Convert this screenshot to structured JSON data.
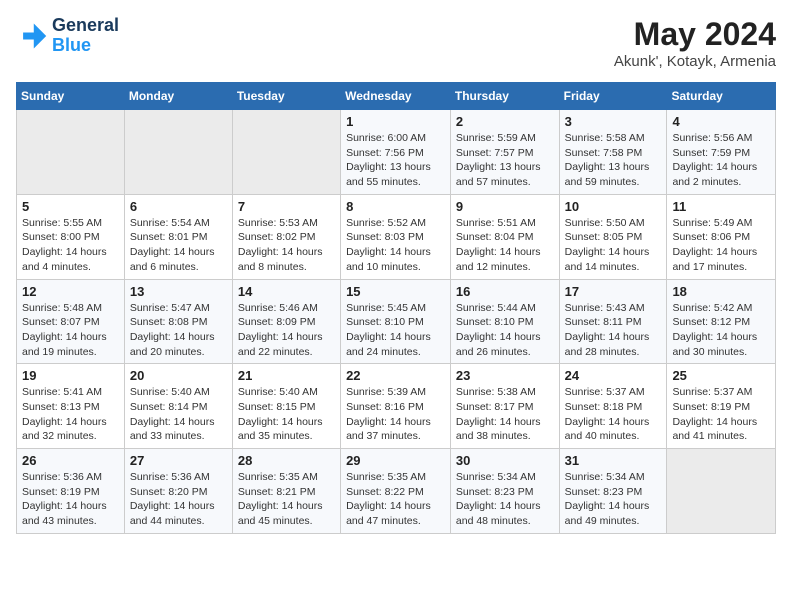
{
  "header": {
    "logo_line1": "General",
    "logo_line2": "Blue",
    "title": "May 2024",
    "subtitle": "Akunk', Kotayk, Armenia"
  },
  "days_of_week": [
    "Sunday",
    "Monday",
    "Tuesday",
    "Wednesday",
    "Thursday",
    "Friday",
    "Saturday"
  ],
  "weeks": [
    {
      "days": [
        {
          "empty": true
        },
        {
          "empty": true
        },
        {
          "empty": true
        },
        {
          "number": "1",
          "sunrise": "6:00 AM",
          "sunset": "7:56 PM",
          "daylight": "13 hours and 55 minutes."
        },
        {
          "number": "2",
          "sunrise": "5:59 AM",
          "sunset": "7:57 PM",
          "daylight": "13 hours and 57 minutes."
        },
        {
          "number": "3",
          "sunrise": "5:58 AM",
          "sunset": "7:58 PM",
          "daylight": "13 hours and 59 minutes."
        },
        {
          "number": "4",
          "sunrise": "5:56 AM",
          "sunset": "7:59 PM",
          "daylight": "14 hours and 2 minutes."
        }
      ]
    },
    {
      "days": [
        {
          "number": "5",
          "sunrise": "5:55 AM",
          "sunset": "8:00 PM",
          "daylight": "14 hours and 4 minutes."
        },
        {
          "number": "6",
          "sunrise": "5:54 AM",
          "sunset": "8:01 PM",
          "daylight": "14 hours and 6 minutes."
        },
        {
          "number": "7",
          "sunrise": "5:53 AM",
          "sunset": "8:02 PM",
          "daylight": "14 hours and 8 minutes."
        },
        {
          "number": "8",
          "sunrise": "5:52 AM",
          "sunset": "8:03 PM",
          "daylight": "14 hours and 10 minutes."
        },
        {
          "number": "9",
          "sunrise": "5:51 AM",
          "sunset": "8:04 PM",
          "daylight": "14 hours and 12 minutes."
        },
        {
          "number": "10",
          "sunrise": "5:50 AM",
          "sunset": "8:05 PM",
          "daylight": "14 hours and 14 minutes."
        },
        {
          "number": "11",
          "sunrise": "5:49 AM",
          "sunset": "8:06 PM",
          "daylight": "14 hours and 17 minutes."
        }
      ]
    },
    {
      "days": [
        {
          "number": "12",
          "sunrise": "5:48 AM",
          "sunset": "8:07 PM",
          "daylight": "14 hours and 19 minutes."
        },
        {
          "number": "13",
          "sunrise": "5:47 AM",
          "sunset": "8:08 PM",
          "daylight": "14 hours and 20 minutes."
        },
        {
          "number": "14",
          "sunrise": "5:46 AM",
          "sunset": "8:09 PM",
          "daylight": "14 hours and 22 minutes."
        },
        {
          "number": "15",
          "sunrise": "5:45 AM",
          "sunset": "8:10 PM",
          "daylight": "14 hours and 24 minutes."
        },
        {
          "number": "16",
          "sunrise": "5:44 AM",
          "sunset": "8:10 PM",
          "daylight": "14 hours and 26 minutes."
        },
        {
          "number": "17",
          "sunrise": "5:43 AM",
          "sunset": "8:11 PM",
          "daylight": "14 hours and 28 minutes."
        },
        {
          "number": "18",
          "sunrise": "5:42 AM",
          "sunset": "8:12 PM",
          "daylight": "14 hours and 30 minutes."
        }
      ]
    },
    {
      "days": [
        {
          "number": "19",
          "sunrise": "5:41 AM",
          "sunset": "8:13 PM",
          "daylight": "14 hours and 32 minutes."
        },
        {
          "number": "20",
          "sunrise": "5:40 AM",
          "sunset": "8:14 PM",
          "daylight": "14 hours and 33 minutes."
        },
        {
          "number": "21",
          "sunrise": "5:40 AM",
          "sunset": "8:15 PM",
          "daylight": "14 hours and 35 minutes."
        },
        {
          "number": "22",
          "sunrise": "5:39 AM",
          "sunset": "8:16 PM",
          "daylight": "14 hours and 37 minutes."
        },
        {
          "number": "23",
          "sunrise": "5:38 AM",
          "sunset": "8:17 PM",
          "daylight": "14 hours and 38 minutes."
        },
        {
          "number": "24",
          "sunrise": "5:37 AM",
          "sunset": "8:18 PM",
          "daylight": "14 hours and 40 minutes."
        },
        {
          "number": "25",
          "sunrise": "5:37 AM",
          "sunset": "8:19 PM",
          "daylight": "14 hours and 41 minutes."
        }
      ]
    },
    {
      "days": [
        {
          "number": "26",
          "sunrise": "5:36 AM",
          "sunset": "8:19 PM",
          "daylight": "14 hours and 43 minutes."
        },
        {
          "number": "27",
          "sunrise": "5:36 AM",
          "sunset": "8:20 PM",
          "daylight": "14 hours and 44 minutes."
        },
        {
          "number": "28",
          "sunrise": "5:35 AM",
          "sunset": "8:21 PM",
          "daylight": "14 hours and 45 minutes."
        },
        {
          "number": "29",
          "sunrise": "5:35 AM",
          "sunset": "8:22 PM",
          "daylight": "14 hours and 47 minutes."
        },
        {
          "number": "30",
          "sunrise": "5:34 AM",
          "sunset": "8:23 PM",
          "daylight": "14 hours and 48 minutes."
        },
        {
          "number": "31",
          "sunrise": "5:34 AM",
          "sunset": "8:23 PM",
          "daylight": "14 hours and 49 minutes."
        },
        {
          "empty": true
        }
      ]
    }
  ],
  "labels": {
    "sunrise": "Sunrise:",
    "sunset": "Sunset:",
    "daylight": "Daylight:"
  }
}
